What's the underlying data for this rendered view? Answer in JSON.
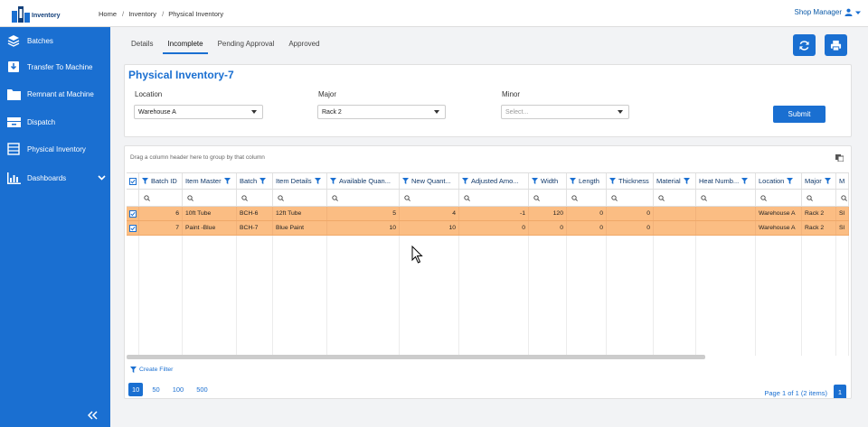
{
  "app": {
    "logo_text": "Inventory"
  },
  "breadcrumb": [
    "Home",
    "Inventory",
    "Physical Inventory"
  ],
  "user": {
    "name": "Shop Manager"
  },
  "sidebar": {
    "items": [
      {
        "label": "Batches",
        "icon": "layers-icon"
      },
      {
        "label": "Transfer To Machine",
        "icon": "download-box-icon"
      },
      {
        "label": "Remnant at Machine",
        "icon": "folder-icon"
      },
      {
        "label": "Dispatch",
        "icon": "truck-icon"
      },
      {
        "label": "Physical Inventory",
        "icon": "drawers-icon"
      },
      {
        "label": "Dashboards",
        "icon": "bar-chart-icon"
      }
    ]
  },
  "tabs": [
    "Details",
    "Incomplete",
    "Pending Approval",
    "Approved"
  ],
  "active_tab": "Incomplete",
  "form": {
    "title": "Physical Inventory-7",
    "location": {
      "label": "Location",
      "value": "Warehouse A"
    },
    "major": {
      "label": "Major",
      "value": "Rack 2"
    },
    "minor": {
      "label": "Minor",
      "placeholder": "Select..."
    },
    "submit_label": "Submit"
  },
  "grid": {
    "group_hint": "Drag a column header here to group by that column",
    "columns": [
      "Batch ID",
      "Item Master",
      "Batch",
      "Item Details",
      "Available Quan...",
      "New Quant...",
      "Adjusted Amo...",
      "Width",
      "Length",
      "Thickness",
      "Material",
      "Heat Numb...",
      "Location",
      "Major",
      "M"
    ],
    "rows": [
      [
        "6",
        "10ft Tube",
        "BCH-6",
        "12ft Tube",
        "5",
        "4",
        "-1",
        "120",
        "0",
        "0",
        "",
        "",
        "Warehouse A",
        "Rack 2",
        "Sl"
      ],
      [
        "7",
        "Paint -Blue",
        "BCH-7",
        "Blue Paint",
        "10",
        "10",
        "0",
        "0",
        "0",
        "0",
        "",
        "",
        "Warehouse A",
        "Rack 2",
        "Sl"
      ]
    ],
    "create_filter": "Create Filter",
    "page_sizes": [
      "10",
      "50",
      "100",
      "500"
    ],
    "active_page_size": "10",
    "page_info": "Page 1 of 1 (2 items)",
    "current_page": "1"
  },
  "colors": {
    "accent": "#1a6fd1",
    "selected_row": "#fbbd83"
  }
}
